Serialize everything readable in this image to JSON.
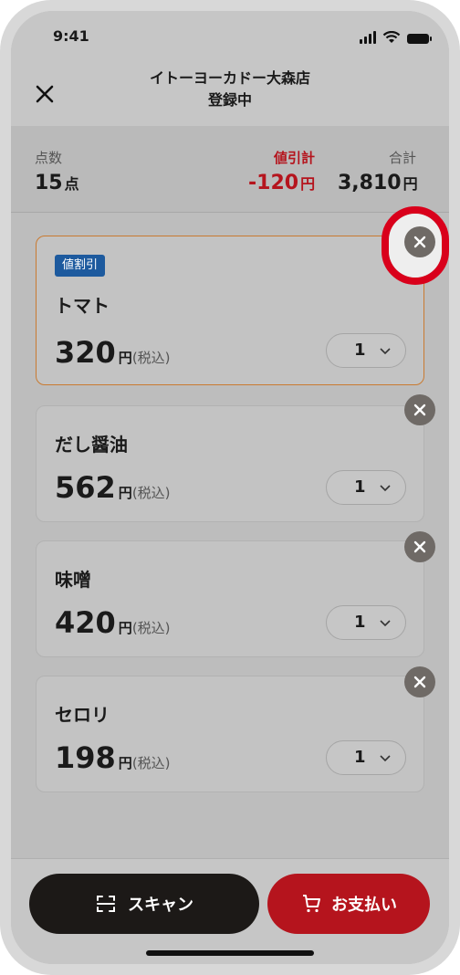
{
  "status_bar": {
    "time": "9:41"
  },
  "header": {
    "store_name": "イトーヨーカドー大森店",
    "status": "登録中",
    "close_icon": "close-icon"
  },
  "summary": {
    "count_label": "点数",
    "count_value": "15",
    "count_unit": "点",
    "discount_label": "値引計",
    "discount_value": "-120",
    "discount_unit": "円",
    "total_label": "合計",
    "total_value": "3,810",
    "total_unit": "円"
  },
  "items": [
    {
      "badge": "値割引",
      "name": "トマト",
      "price": "320",
      "yen": "円",
      "tax": "(税込)",
      "qty": "1"
    },
    {
      "name": "だし醤油",
      "price": "562",
      "yen": "円",
      "tax": "(税込)",
      "qty": "1"
    },
    {
      "name": "味噌",
      "price": "420",
      "yen": "円",
      "tax": "(税込)",
      "qty": "1"
    },
    {
      "name": "セロリ",
      "price": "198",
      "yen": "円",
      "tax": "(税込)",
      "qty": "1"
    }
  ],
  "footer": {
    "scan_label": "スキャン",
    "pay_label": "お支払い"
  },
  "colors": {
    "accent_red": "#b5141d",
    "badge_blue": "#1d5a9e",
    "selected_border": "#c97a30"
  }
}
